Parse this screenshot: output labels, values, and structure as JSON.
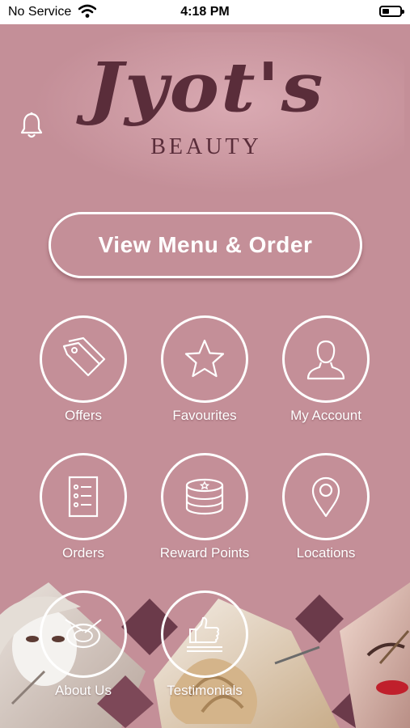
{
  "status_bar": {
    "carrier": "No Service",
    "time": "4:18 PM"
  },
  "logo": {
    "name": "Jyot's",
    "tagline": "BEAUTY"
  },
  "main_button": {
    "label": "View Menu & Order"
  },
  "menu": [
    {
      "label": "Offers",
      "icon": "tag-icon"
    },
    {
      "label": "Favourites",
      "icon": "star-icon"
    },
    {
      "label": "My Account",
      "icon": "user-icon"
    },
    {
      "label": "Orders",
      "icon": "clipboard-list-icon"
    },
    {
      "label": "Reward Points",
      "icon": "coin-stack-icon"
    },
    {
      "label": "Locations",
      "icon": "map-pin-icon"
    },
    {
      "label": "About Us",
      "icon": "plate-cutlery-icon"
    },
    {
      "label": "Testimonials",
      "icon": "thumbs-up-icon"
    }
  ],
  "colors": {
    "background": "#c48f98",
    "logo": "#5a2d3a",
    "accent_dark": "#6b3a4a"
  }
}
